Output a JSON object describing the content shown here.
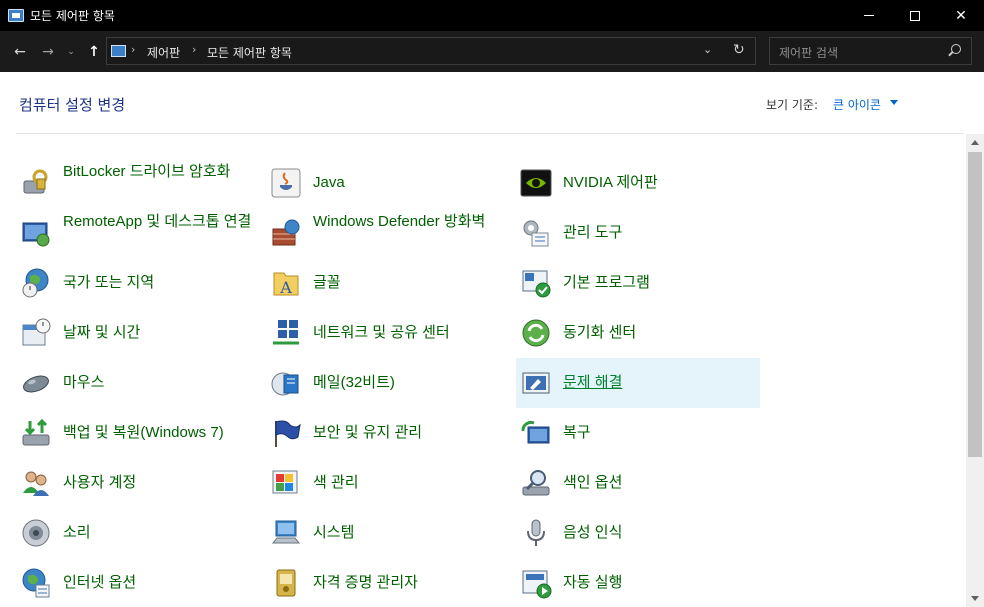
{
  "window": {
    "title": "모든 제어판 항목"
  },
  "nav": {
    "breadcrumb": [
      "제어판",
      "모든 제어판 항목"
    ],
    "search_placeholder": "제어판 검색"
  },
  "header": {
    "title": "컴퓨터 설정 변경",
    "view_label": "보기 기준:",
    "view_value": "큰 아이콘"
  },
  "items": [
    {
      "label": "BitLocker 드라이브 암호화",
      "icon": "bitlocker-icon"
    },
    {
      "label": "Java",
      "icon": "java-icon"
    },
    {
      "label": "NVIDIA 제어판",
      "icon": "nvidia-icon"
    },
    {
      "label": "RemoteApp 및 데스크톱 연결",
      "icon": "remoteapp-icon"
    },
    {
      "label": "Windows Defender 방화벽",
      "icon": "firewall-icon"
    },
    {
      "label": "관리 도구",
      "icon": "admin-tools-icon"
    },
    {
      "label": "국가 또는 지역",
      "icon": "region-icon"
    },
    {
      "label": "글꼴",
      "icon": "fonts-icon"
    },
    {
      "label": "기본 프로그램",
      "icon": "default-programs-icon"
    },
    {
      "label": "날짜 및 시간",
      "icon": "date-time-icon"
    },
    {
      "label": "네트워크 및 공유 센터",
      "icon": "network-icon"
    },
    {
      "label": "동기화 센터",
      "icon": "sync-icon"
    },
    {
      "label": "마우스",
      "icon": "mouse-icon"
    },
    {
      "label": "메일(32비트)",
      "icon": "mail-icon"
    },
    {
      "label": "문제 해결",
      "icon": "troubleshoot-icon"
    },
    {
      "label": "백업 및 복원(Windows 7)",
      "icon": "backup-icon"
    },
    {
      "label": "보안 및 유지 관리",
      "icon": "security-flag-icon"
    },
    {
      "label": "복구",
      "icon": "recovery-icon"
    },
    {
      "label": "사용자 계정",
      "icon": "user-accounts-icon"
    },
    {
      "label": "색 관리",
      "icon": "color-management-icon"
    },
    {
      "label": "색인 옵션",
      "icon": "indexing-icon"
    },
    {
      "label": "소리",
      "icon": "sound-icon"
    },
    {
      "label": "시스템",
      "icon": "system-icon"
    },
    {
      "label": "음성 인식",
      "icon": "speech-icon"
    },
    {
      "label": "인터넷 옵션",
      "icon": "internet-options-icon"
    },
    {
      "label": "자격 증명 관리자",
      "icon": "credential-icon"
    },
    {
      "label": "자동 실행",
      "icon": "autoplay-icon"
    }
  ],
  "colors": {
    "link_green": "#006000",
    "title_blue": "#1e3287",
    "hover_bg": "#e5f3fb"
  }
}
